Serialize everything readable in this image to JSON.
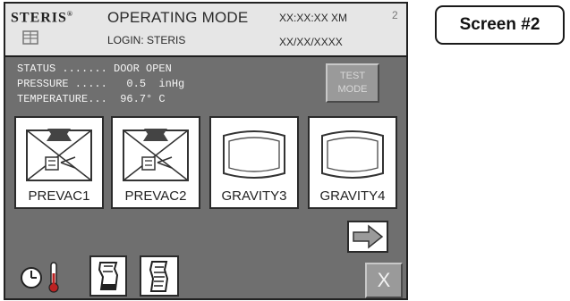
{
  "header": {
    "brand": "STERIS",
    "brand_mark": "®",
    "mode_title": "OPERATING MODE",
    "login": "LOGIN: STERIS",
    "time": "XX:XX:XX XM",
    "date": "XX/XX/XXXX",
    "page_number": "2"
  },
  "status": {
    "line1": "STATUS ....... DOOR OPEN",
    "line2": "PRESSURE .....   0.5  inHg",
    "line3": "TEMPERATURE...  96.7° C"
  },
  "test_mode_button": {
    "line1": "TEST",
    "line2": "MODE"
  },
  "cycles": [
    {
      "label": "PREVAC1",
      "icon": "prevac-chamber-icon"
    },
    {
      "label": "PREVAC2",
      "icon": "prevac-chamber-icon"
    },
    {
      "label": "GRAVITY3",
      "icon": "gravity-chamber-icon"
    },
    {
      "label": "GRAVITY4",
      "icon": "gravity-chamber-icon"
    }
  ],
  "next_button_icon": "right-arrow-icon",
  "tools": [
    {
      "icon": "clock-thermometer-icon"
    },
    {
      "icon": "printer-icon"
    },
    {
      "icon": "report-icon"
    }
  ],
  "close_button": "X",
  "screen_label": "Screen #2"
}
